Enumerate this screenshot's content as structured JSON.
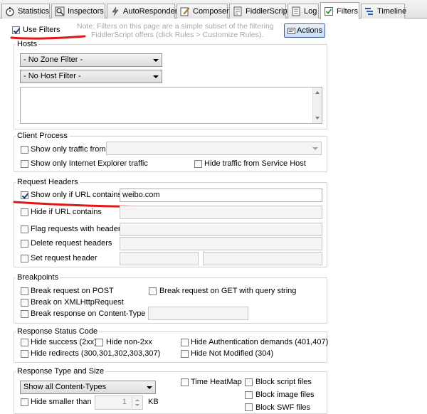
{
  "tabs": [
    {
      "label": "Statistics",
      "icon": "stopwatch-icon"
    },
    {
      "label": "Inspectors",
      "icon": "inspectors-icon"
    },
    {
      "label": "AutoResponder",
      "icon": "lightning-icon"
    },
    {
      "label": "Composer",
      "icon": "composer-icon"
    },
    {
      "label": "FiddlerScript",
      "icon": "script-icon"
    },
    {
      "label": "Log",
      "icon": "log-icon"
    },
    {
      "label": "Filters",
      "icon": "filters-checkbox-icon",
      "active": true
    },
    {
      "label": "Timeline",
      "icon": "timeline-icon"
    }
  ],
  "top": {
    "use_filters_label": "Use Filters",
    "use_filters_checked": true,
    "note_line1": "Note: Filters on this page are a simple subset of the filtering",
    "note_line2": "FiddlerScript offers (click Rules > Customize Rules).",
    "actions_label": "Actions"
  },
  "hosts": {
    "title": "Hosts",
    "zone_filter": "- No Zone Filter -",
    "host_filter": "- No Host Filter -"
  },
  "client_process": {
    "title": "Client Process",
    "traffic_from_label": "Show only traffic from",
    "ie_label": "Show only Internet Explorer traffic",
    "service_host_label": "Hide traffic from Service Host"
  },
  "request_headers": {
    "title": "Request Headers",
    "url_contains_label": "Show only if URL contains",
    "url_contains_value": "weibo.com",
    "hide_url_label": "Hide if URL contains",
    "flag_label": "Flag requests with headers",
    "delete_label": "Delete request headers",
    "set_label": "Set request header"
  },
  "breakpoints": {
    "title": "Breakpoints",
    "post_label": "Break request on POST",
    "get_label": "Break request on GET with query string",
    "xhr_label": "Break on XMLHttpRequest",
    "content_type_label": "Break response on Content-Type"
  },
  "status_code": {
    "title": "Response Status Code",
    "success_label": "Hide success (2xx)",
    "non2xx_label": "Hide non-2xx",
    "auth_label": "Hide Authentication demands (401,407)",
    "redirects_label": "Hide redirects (300,301,302,303,307)",
    "not_modified_label": "Hide Not Modified (304)"
  },
  "type_size": {
    "title": "Response Type and Size",
    "content_types": "Show all Content-Types",
    "heatmap_label": "Time HeatMap",
    "block_script_label": "Block script files",
    "block_image_label": "Block image files",
    "block_swf_label": "Block SWF files",
    "smaller_label": "Hide smaller than",
    "smaller_value": "1",
    "smaller_unit": "KB"
  },
  "colors": {
    "annotation_red": "#e01818",
    "active_tab_check": "#2a9a3a"
  }
}
